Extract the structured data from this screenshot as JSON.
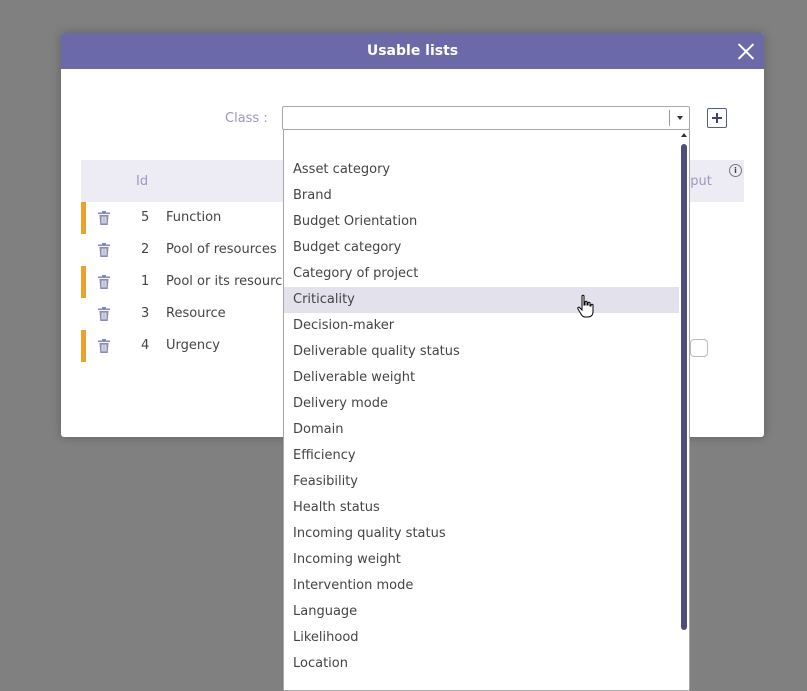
{
  "dialog": {
    "title": "Usable lists",
    "class_label": "Class :",
    "class_value": "",
    "columns": {
      "id": "Id",
      "input": "nput"
    }
  },
  "rows": [
    {
      "id": "5",
      "name": "Function",
      "marked": true
    },
    {
      "id": "2",
      "name": "Pool of resources",
      "marked": false
    },
    {
      "id": "1",
      "name": "Pool or its resource",
      "marked": true
    },
    {
      "id": "3",
      "name": "Resource",
      "marked": false
    },
    {
      "id": "4",
      "name": "Urgency",
      "marked": true
    }
  ],
  "dropdown": {
    "highlighted": "Criticality",
    "items": [
      "",
      "Asset category",
      "Brand",
      "Budget Orientation",
      "Budget category",
      "Category of project",
      "Criticality",
      "Decision-maker",
      "Deliverable quality status",
      "Deliverable weight",
      "Delivery mode",
      "Domain",
      "Efficiency",
      "Feasibility",
      "Health status",
      "Incoming quality status",
      "Incoming weight",
      "Intervention mode",
      "Language",
      "Likelihood",
      "Location"
    ]
  },
  "colors": {
    "header": "#6b69a8",
    "accent_marker": "#e9a22b",
    "label": "#9a98c0",
    "highlight": "#e2e1ec",
    "scroll_thumb": "#4f4d79"
  },
  "icons": {
    "close": "close-icon",
    "add": "plus-icon",
    "delete": "trash-icon",
    "info": "info-icon",
    "dropdown": "chevron-down-icon",
    "cursor": "hand-cursor-icon"
  }
}
